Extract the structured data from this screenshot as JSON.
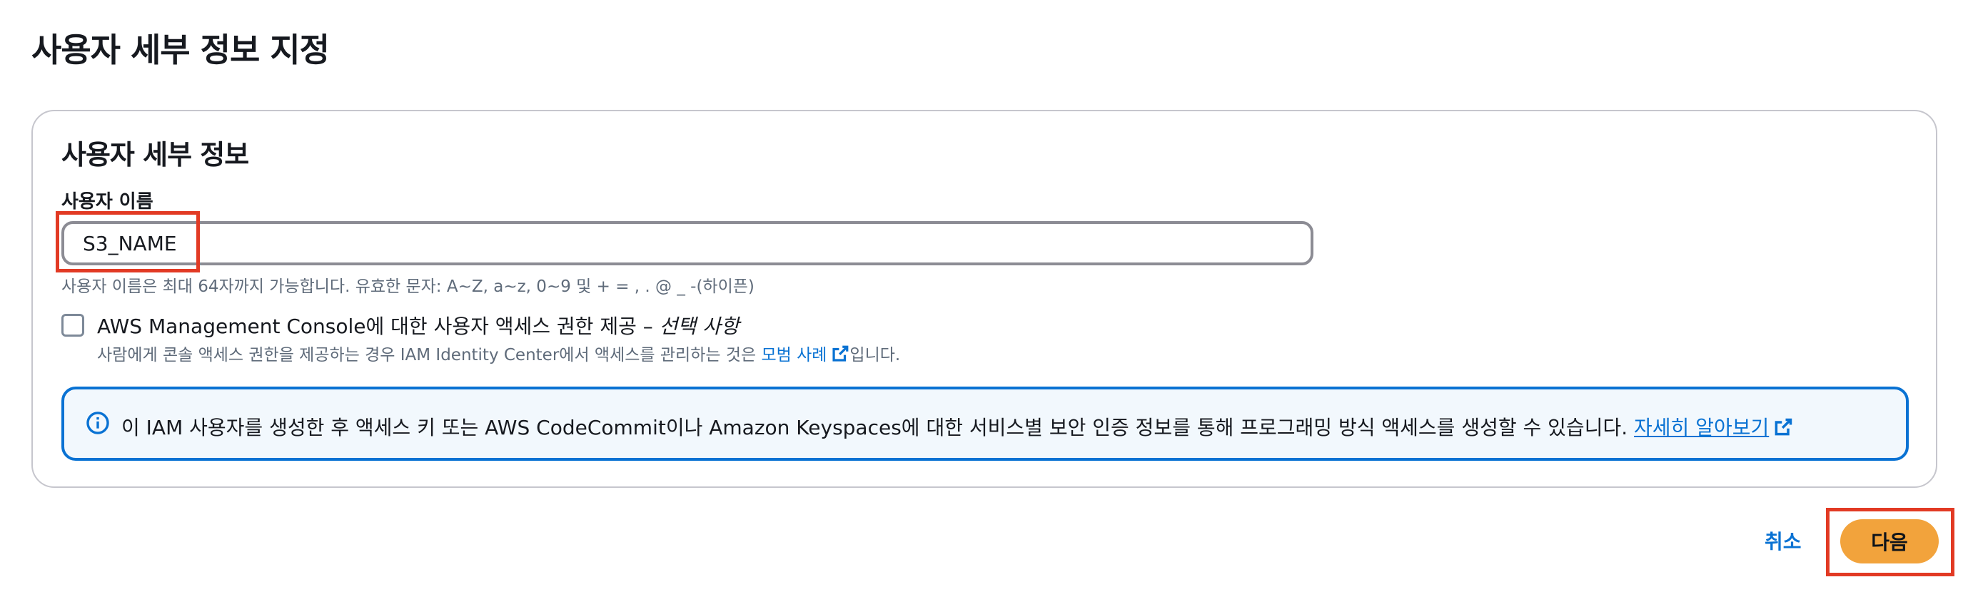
{
  "page": {
    "title": "사용자 세부 정보 지정"
  },
  "panel": {
    "title": "사용자 세부 정보",
    "username_label": "사용자 이름",
    "username_value": "S3_NAME",
    "username_hint": "사용자 이름은 최대 64자까지 가능합니다. 유효한 문자: A~Z, a~z, 0~9 및 + = , . @ _ -(하이픈)",
    "console_access": {
      "checked": false,
      "label": "AWS Management Console에 대한 사용자 액세스 권한 제공 – ",
      "label_optional": "선택 사항",
      "description_prefix": "사람에게 콘솔 액세스 권한을 제공하는 경우 IAM Identity Center에서 액세스를 관리하는 것은 ",
      "description_link": "모범 사례",
      "description_suffix": "입니다."
    },
    "info_alert": {
      "text": "이 IAM 사용자를 생성한 후 액세스 키 또는 AWS CodeCommit이나 Amazon Keyspaces에 대한 서비스별 보안 인증 정보를 통해 프로그래밍 방식 액세스를 생성할 수 있습니다. ",
      "link": "자세히 알아보기"
    }
  },
  "footer": {
    "cancel_label": "취소",
    "next_label": "다음"
  },
  "colors": {
    "primary_button": "#f2a33c",
    "link": "#0972d3",
    "alert_border": "#0972d3",
    "alert_background": "#f2f8fd",
    "annotation_box": "#e23a24"
  },
  "icons": {
    "info": "info-icon",
    "external_link": "external-link-icon"
  }
}
